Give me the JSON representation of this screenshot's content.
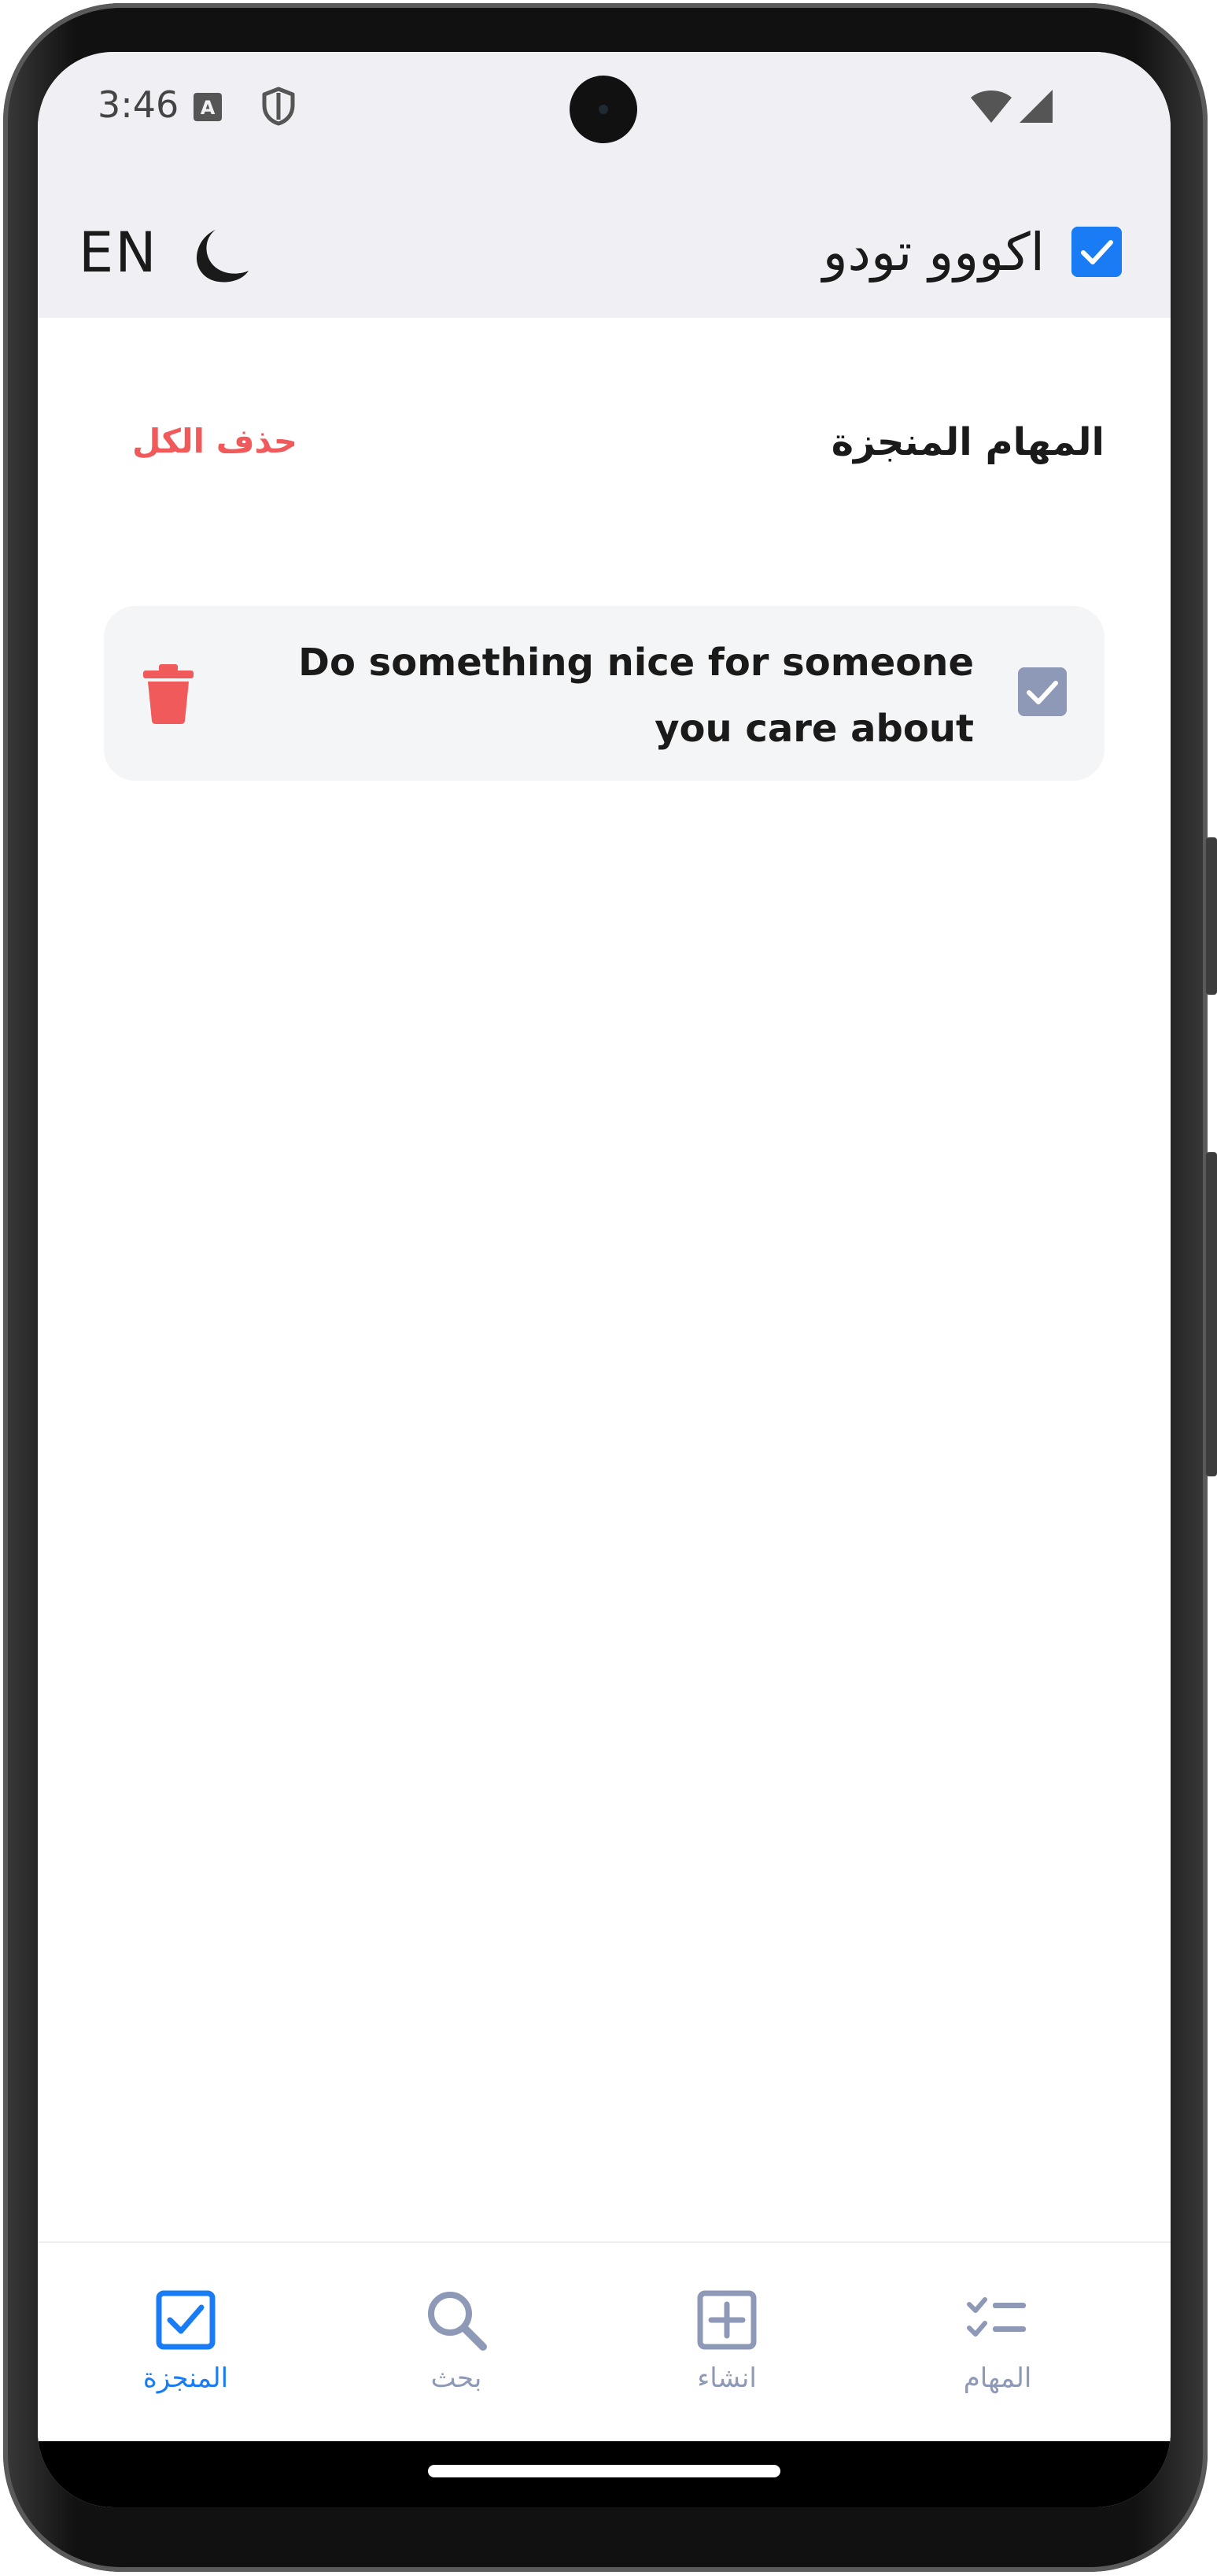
{
  "status_bar": {
    "time": "3:46",
    "icons": [
      "keyboard-a-icon",
      "shield-icon",
      "wifi-icon",
      "signal-icon"
    ]
  },
  "app_bar": {
    "language_toggle": "EN",
    "theme_icon": "moon-icon",
    "title": "اكووو تودو",
    "logo_icon": "checkbox-icon"
  },
  "section": {
    "title": "المهام المنجزة",
    "delete_all_label": "حذف الكل"
  },
  "tasks": [
    {
      "text": "Do something nice for someone you care about",
      "completed": true
    }
  ],
  "bottom_nav": {
    "items": [
      {
        "label": "المنجزة",
        "icon": "checkbox-icon",
        "active": true
      },
      {
        "label": "بحث",
        "icon": "search-icon",
        "active": false
      },
      {
        "label": "انشاء",
        "icon": "plus-square-icon",
        "active": false
      },
      {
        "label": "المهام",
        "icon": "task-list-icon",
        "active": false
      }
    ]
  },
  "colors": {
    "accent": "#1a7cf5",
    "danger": "#f05a5a",
    "muted": "#8d99b6",
    "app_bar_bg": "#efeff4",
    "card_bg": "#f4f5f7"
  }
}
